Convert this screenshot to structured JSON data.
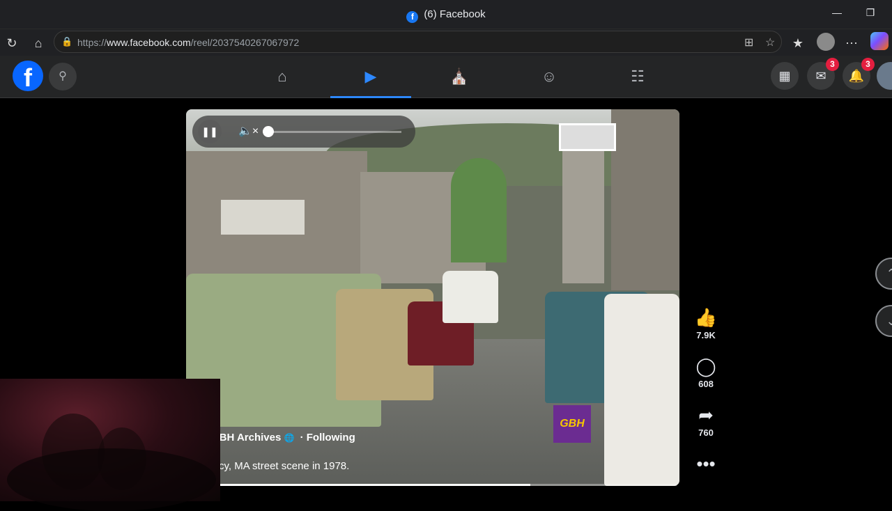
{
  "browser": {
    "tab_title": "(6) Facebook",
    "favicon_letter": "f",
    "url_prefix": "https://",
    "url_domain": "www.facebook.com",
    "url_path": "/reel/2037540267067972"
  },
  "fb_header": {
    "logo_letter": "f",
    "nav_tabs": [
      "home-icon",
      "reels-icon",
      "marketplace-icon",
      "groups-icon",
      "gaming-icon"
    ],
    "active_tab": "reels-icon",
    "messenger_badge": "3",
    "notifications_badge": "3"
  },
  "reel": {
    "author": "GBH Archives",
    "follow_status": "· Following",
    "caption": "cy, MA street scene in 1978.",
    "watermark": "GBH",
    "progress_fraction": 0.68,
    "volume_fraction": 0.0,
    "likes": "7.9K",
    "comments": "608",
    "shares": "760"
  },
  "colors": {
    "fb_blue": "#0866ff",
    "active_tab": "#2d88ff",
    "badge_red": "#e41e3f",
    "header_bg": "#242526"
  }
}
